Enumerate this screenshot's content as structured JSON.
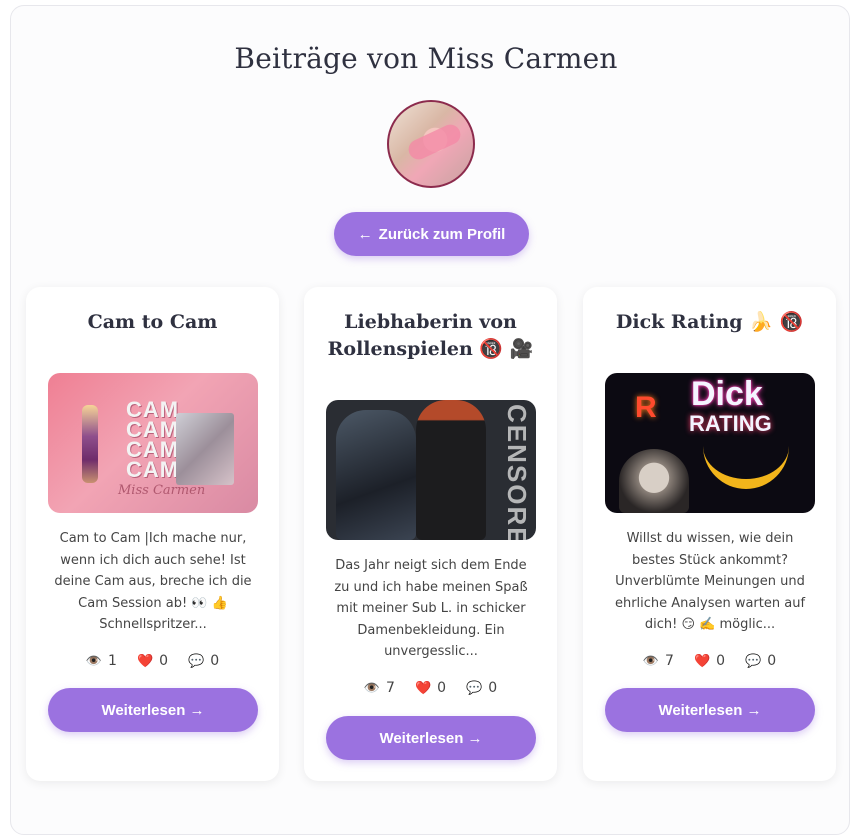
{
  "page": {
    "title": "Beiträge von Miss Carmen",
    "back_button": {
      "arrow": "←",
      "label": "Zurück zum Profil"
    }
  },
  "posts": [
    {
      "title": "Cam to Cam",
      "image_icon": "post-thumbnail",
      "image_text": [
        "CAM",
        "CAM",
        "CAM",
        "CAM",
        "Miss Carmen"
      ],
      "excerpt": "Cam to Cam |Ich mache nur, wenn ich dich auch sehe! Ist deine Cam aus, breche ich die Cam Session ab! 👀 👍 Schnellspritzer...",
      "views": "1",
      "likes": "0",
      "comments": "0",
      "button": "Weiterlesen →"
    },
    {
      "title": "Liebhaberin von Rollenspielen 🔞 🎥",
      "image_icon": "post-thumbnail",
      "image_text": [
        "CENSORED"
      ],
      "excerpt": "Das Jahr neigt sich dem Ende zu und ich habe meinen Spaß mit meiner Sub L. in schicker Damenbekleidung. Ein unvergesslic...",
      "views": "7",
      "likes": "0",
      "comments": "0",
      "button": "Weiterlesen →"
    },
    {
      "title": "Dick Rating 🍌 🔞",
      "image_icon": "post-thumbnail",
      "image_text": [
        "Dick",
        "RATING",
        "R"
      ],
      "excerpt": "Willst du wissen, wie dein bestes Stück ankommt? Unverblümte Meinungen und ehrliche Analysen warten auf dich! 😏 ✍️ möglic...",
      "views": "7",
      "likes": "0",
      "comments": "0",
      "button": "Weiterlesen →"
    }
  ],
  "icons": {
    "views": "eye-icon",
    "likes": "heart-icon",
    "comments": "speech-bubble-icon"
  },
  "colors": {
    "accent": "#9b72e0",
    "avatar_border": "#8c2b4d",
    "heart": "#e8315b"
  }
}
